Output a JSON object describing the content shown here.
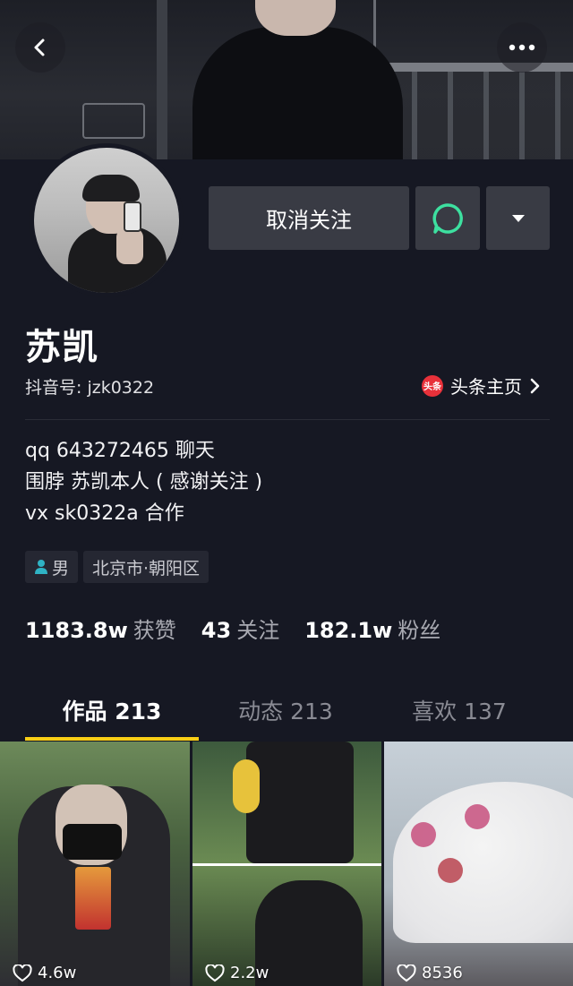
{
  "header": {
    "back_icon": "chevron-left-icon",
    "more_icon": "ellipsis-icon"
  },
  "actions": {
    "unfollow_label": "取消关注",
    "chat_icon": "chat-bubble-icon",
    "dropdown_icon": "caret-down-icon"
  },
  "profile": {
    "name": "苏凯",
    "douyin_id": "抖音号: jzk0322",
    "toutiao_badge": "头条",
    "toutiao_label": "头条主页",
    "bio": [
      "qq 643272465 聊天",
      "围脖 苏凯本人 ( 感谢关注 )",
      "vx sk0322a 合作"
    ],
    "tags": {
      "gender": "男",
      "location": "北京市·朝阳区"
    }
  },
  "stats": [
    {
      "value": "1183.8w",
      "label": "获赞"
    },
    {
      "value": "43",
      "label": "关注"
    },
    {
      "value": "182.1w",
      "label": "粉丝"
    }
  ],
  "tabs": [
    {
      "label": "作品 213"
    },
    {
      "label": "动态 213"
    },
    {
      "label": "喜欢 137"
    }
  ],
  "videos": [
    {
      "likes": "4.6w"
    },
    {
      "likes": "2.2w"
    },
    {
      "likes": "8536"
    }
  ],
  "colors": {
    "background": "#161823",
    "accent": "#face15",
    "button": "#393b44",
    "chat_green": "#3de0a0"
  }
}
